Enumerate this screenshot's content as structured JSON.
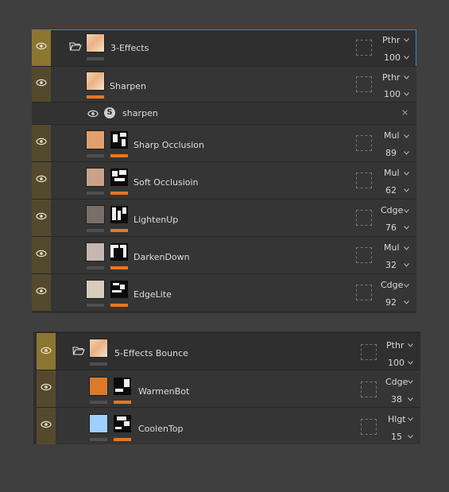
{
  "colors": {
    "accent": "#e87722",
    "selection": "#4a7fc1",
    "eye_group": "#8c7530",
    "eye_layer": "#54492d"
  },
  "panel1": {
    "group": {
      "name": "3-Effects",
      "blend": "Pthr",
      "opacity": "100"
    },
    "sharpen": {
      "name": "Sharpen",
      "blend": "Pthr",
      "opacity": "100"
    },
    "filter": {
      "icon": "S",
      "name": "sharpen",
      "close": "×"
    },
    "layers": [
      {
        "name": "Sharp Occlusion",
        "blend": "Mul",
        "opacity": "89",
        "swatch": "#e0a06e"
      },
      {
        "name": "Soft Occlusioin",
        "blend": "Mul",
        "opacity": "62",
        "swatch": "#c9a28a"
      },
      {
        "name": "LightenUp",
        "blend": "Cdge",
        "opacity": "76",
        "swatch": "#787068"
      },
      {
        "name": "DarkenDown",
        "blend": "Mul",
        "opacity": "32",
        "swatch": "#c4b8b1"
      },
      {
        "name": "EdgeLite",
        "blend": "Cdge",
        "opacity": "92",
        "swatch": "#d5cdb9"
      }
    ]
  },
  "panel2": {
    "group": {
      "name": "5-Effects Bounce",
      "blend": "Pthr",
      "opacity": "100"
    },
    "layers": [
      {
        "name": "WarmenBot",
        "blend": "Cdge",
        "opacity": "38",
        "swatch": "#db7a2a"
      },
      {
        "name": "CoolenTop",
        "blend": "Hlgt",
        "opacity": "15",
        "swatch": "#9fd0ff"
      }
    ]
  }
}
